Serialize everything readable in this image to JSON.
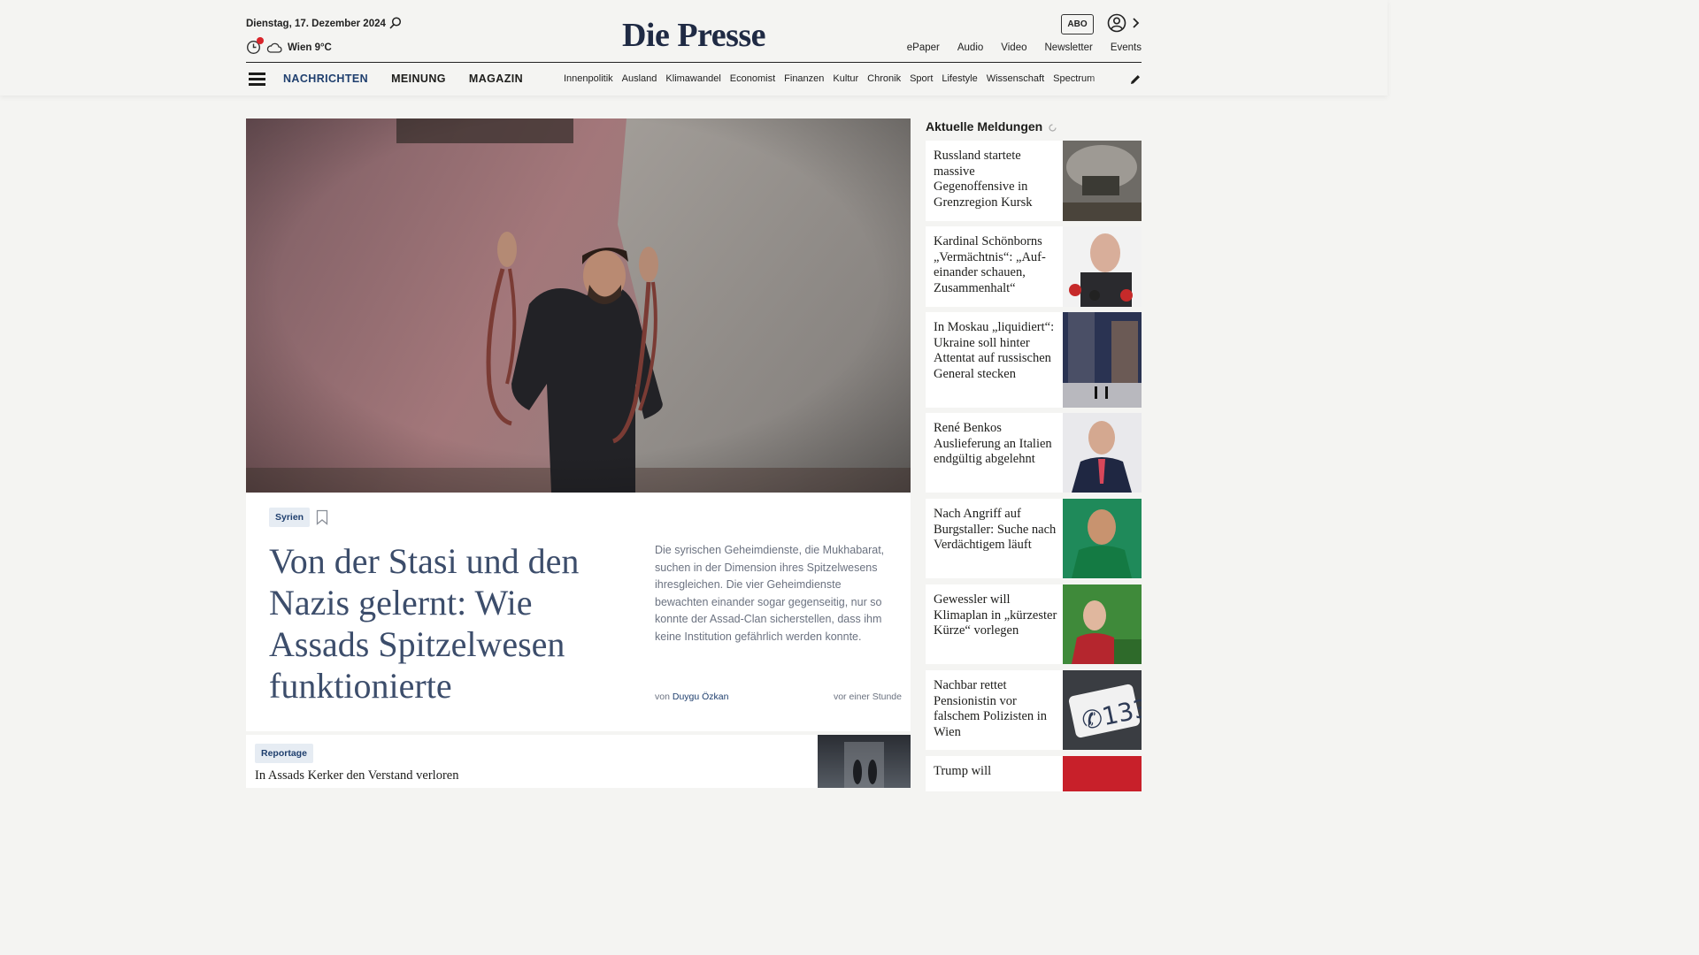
{
  "header": {
    "date": "Dienstag, 17. Dezember 2024",
    "weather": "Wien 9°C",
    "logo": "Die Presse",
    "abo": "ABO",
    "topnav": [
      "ePaper",
      "Audio",
      "Video",
      "Newsletter",
      "Events"
    ],
    "mainnav": [
      "NACHRICHTEN",
      "MEINUNG",
      "MAGAZIN"
    ],
    "subnav": [
      "Innenpolitik",
      "Ausland",
      "Klimawandel",
      "Economist",
      "Finanzen",
      "Kultur",
      "Chronik",
      "Sport",
      "Lifestyle",
      "Wissenschaft",
      "Spectrum"
    ]
  },
  "hero": {
    "tag": "Syrien",
    "title": "Von der Stasi und den Nazis gelernt: Wie Assads Spitzelwesen funktionierte",
    "teaser": "Die syrischen Geheimdienste, die Mukhabarat, suchen in der Dimension ihres Spitzelwesens ihresgleichen. Die vier Geheimdienste bewachten einander sogar gegenseitig, nur so konnte der Assad-Clan sicherstellen, dass ihm keine Institution gefährlich werden konnte.",
    "byline_prefix": "von",
    "author": "Duygu Özkan",
    "time": "vor einer Stunde"
  },
  "second": {
    "tag": "Reportage",
    "title": "In Assads Kerker den Verstand verloren"
  },
  "sidebar": {
    "heading": "Aktuelle Meldungen",
    "items": [
      {
        "title": "Russland startete massive Gegenoffensive in Grenzregion Kursk",
        "image": "tank-in-smoke"
      },
      {
        "title": "Kardinal Schönborns „Vermächtnis“: „Auf­einander schauen, Zusammenhalt“",
        "image": "cardinal-with-microphones"
      },
      {
        "title": "In Moskau „liquidiert“: Ukraine soll hinter Attentat auf russischen General stecken",
        "image": "moscow-street-night"
      },
      {
        "title": "René Benkos Auslieferung an Italien endgültig abgelehnt",
        "image": "man-in-suit"
      },
      {
        "title": "Nach Angriff auf Burgstaller: Suche nach Verdächtigem läuft",
        "image": "footballer-green-jersey"
      },
      {
        "title": "Gewessler will Klimaplan in „kürzester Kürze“ vorlegen",
        "image": "politician-at-lectern"
      },
      {
        "title": "Nachbar rettet Pensionistin vor falschem Polizisten in Wien",
        "image": "phone-133-sign"
      },
      {
        "title": "Trump will",
        "image": "red-photo"
      }
    ]
  }
}
